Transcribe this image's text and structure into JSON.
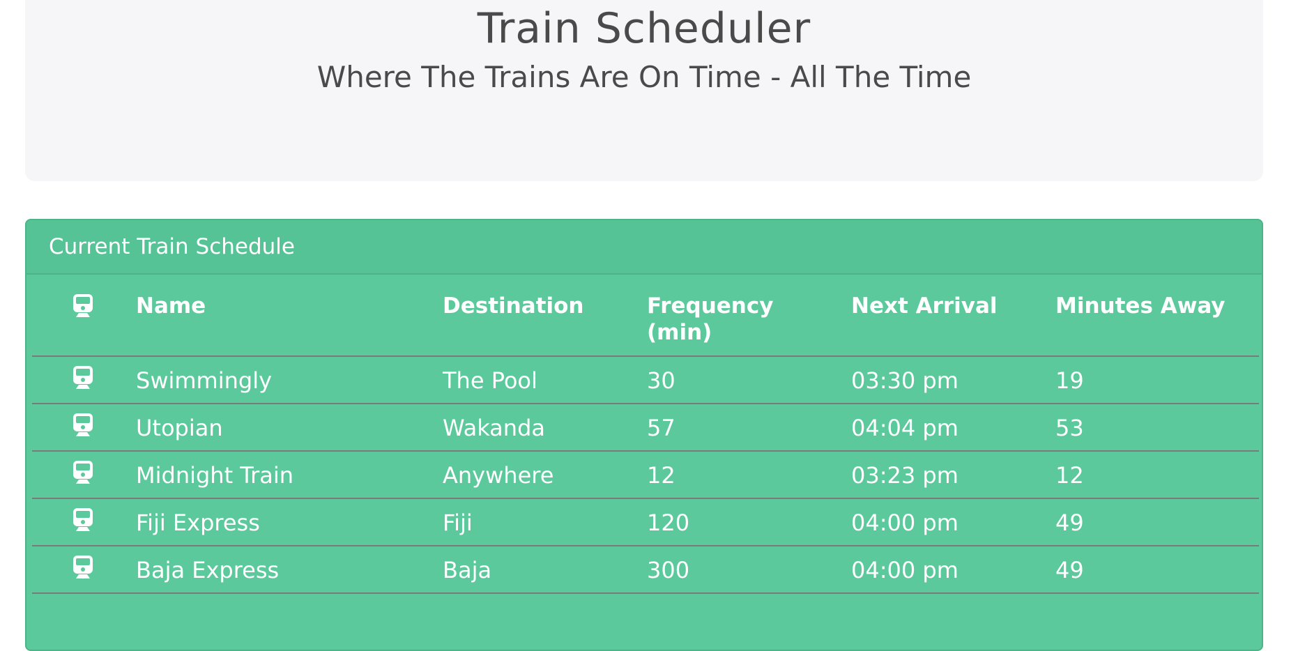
{
  "header": {
    "title": "Train Scheduler",
    "subtitle": "Where The Trains Are On Time - All The Time"
  },
  "panel": {
    "heading": "Current Train Schedule"
  },
  "table": {
    "icon": "train-icon",
    "columns": {
      "name": "Name",
      "destination": "Destination",
      "frequency_line1": "Frequency",
      "frequency_line2": "(min)",
      "next_arrival": "Next Arrival",
      "minutes_away": "Minutes Away"
    },
    "rows": [
      {
        "name": "Swimmingly",
        "destination": "The Pool",
        "frequency": "30",
        "next_arrival": "03:30 pm",
        "minutes_away": "19"
      },
      {
        "name": "Utopian",
        "destination": "Wakanda",
        "frequency": "57",
        "next_arrival": "04:04 pm",
        "minutes_away": "53"
      },
      {
        "name": "Midnight Train",
        "destination": "Anywhere",
        "frequency": "12",
        "next_arrival": "03:23 pm",
        "minutes_away": "12"
      },
      {
        "name": "Fiji Express",
        "destination": "Fiji",
        "frequency": "120",
        "next_arrival": "04:00 pm",
        "minutes_away": "49"
      },
      {
        "name": "Baja Express",
        "destination": "Baja",
        "frequency": "300",
        "next_arrival": "04:00 pm",
        "minutes_away": "49"
      }
    ]
  },
  "colors": {
    "panel_background": "#5cc99c",
    "jumbotron_background": "#f6f6f9",
    "text_dark": "#4a4a4a",
    "text_light": "#ffffff"
  }
}
